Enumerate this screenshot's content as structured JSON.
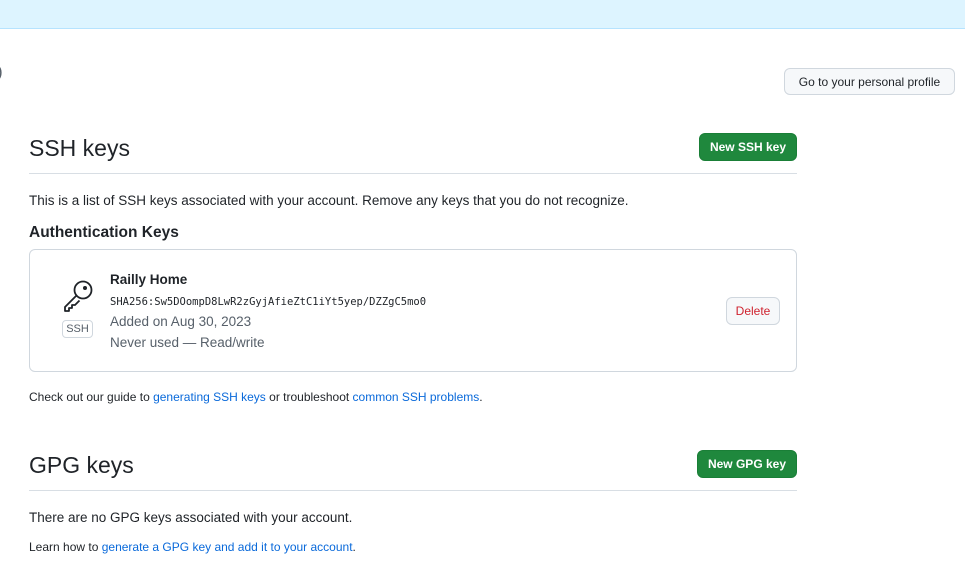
{
  "header": {
    "edge_glyph": ")",
    "profile_button": "Go to your personal profile"
  },
  "ssh": {
    "title": "SSH keys",
    "new_button": "New SSH key",
    "description": "This is a list of SSH keys associated with your account. Remove any keys that you do not recognize.",
    "auth_heading": "Authentication Keys",
    "keys": [
      {
        "name": "Railly Home",
        "fingerprint": "SHA256:Sw5DOompD8LwR2zGyjAfieZtC1iYt5yep/DZZgC5mo0",
        "added": "Added on Aug 30, 2023",
        "usage": "Never used — Read/write",
        "badge": "SSH",
        "delete_label": "Delete"
      }
    ],
    "guide": {
      "prefix": "Check out our guide to ",
      "link1": "generating SSH keys",
      "middle": " or troubleshoot ",
      "link2": "common SSH problems",
      "suffix": "."
    }
  },
  "gpg": {
    "title": "GPG keys",
    "new_button": "New GPG key",
    "empty_text": "There are no GPG keys associated with your account.",
    "learn": {
      "prefix": "Learn how to ",
      "link": "generate a GPG key and add it to your account",
      "suffix": "."
    }
  },
  "colors": {
    "banner": "#ddf4ff",
    "primary_button": "#1f883d",
    "link": "#0969da",
    "danger": "#cf222e"
  }
}
